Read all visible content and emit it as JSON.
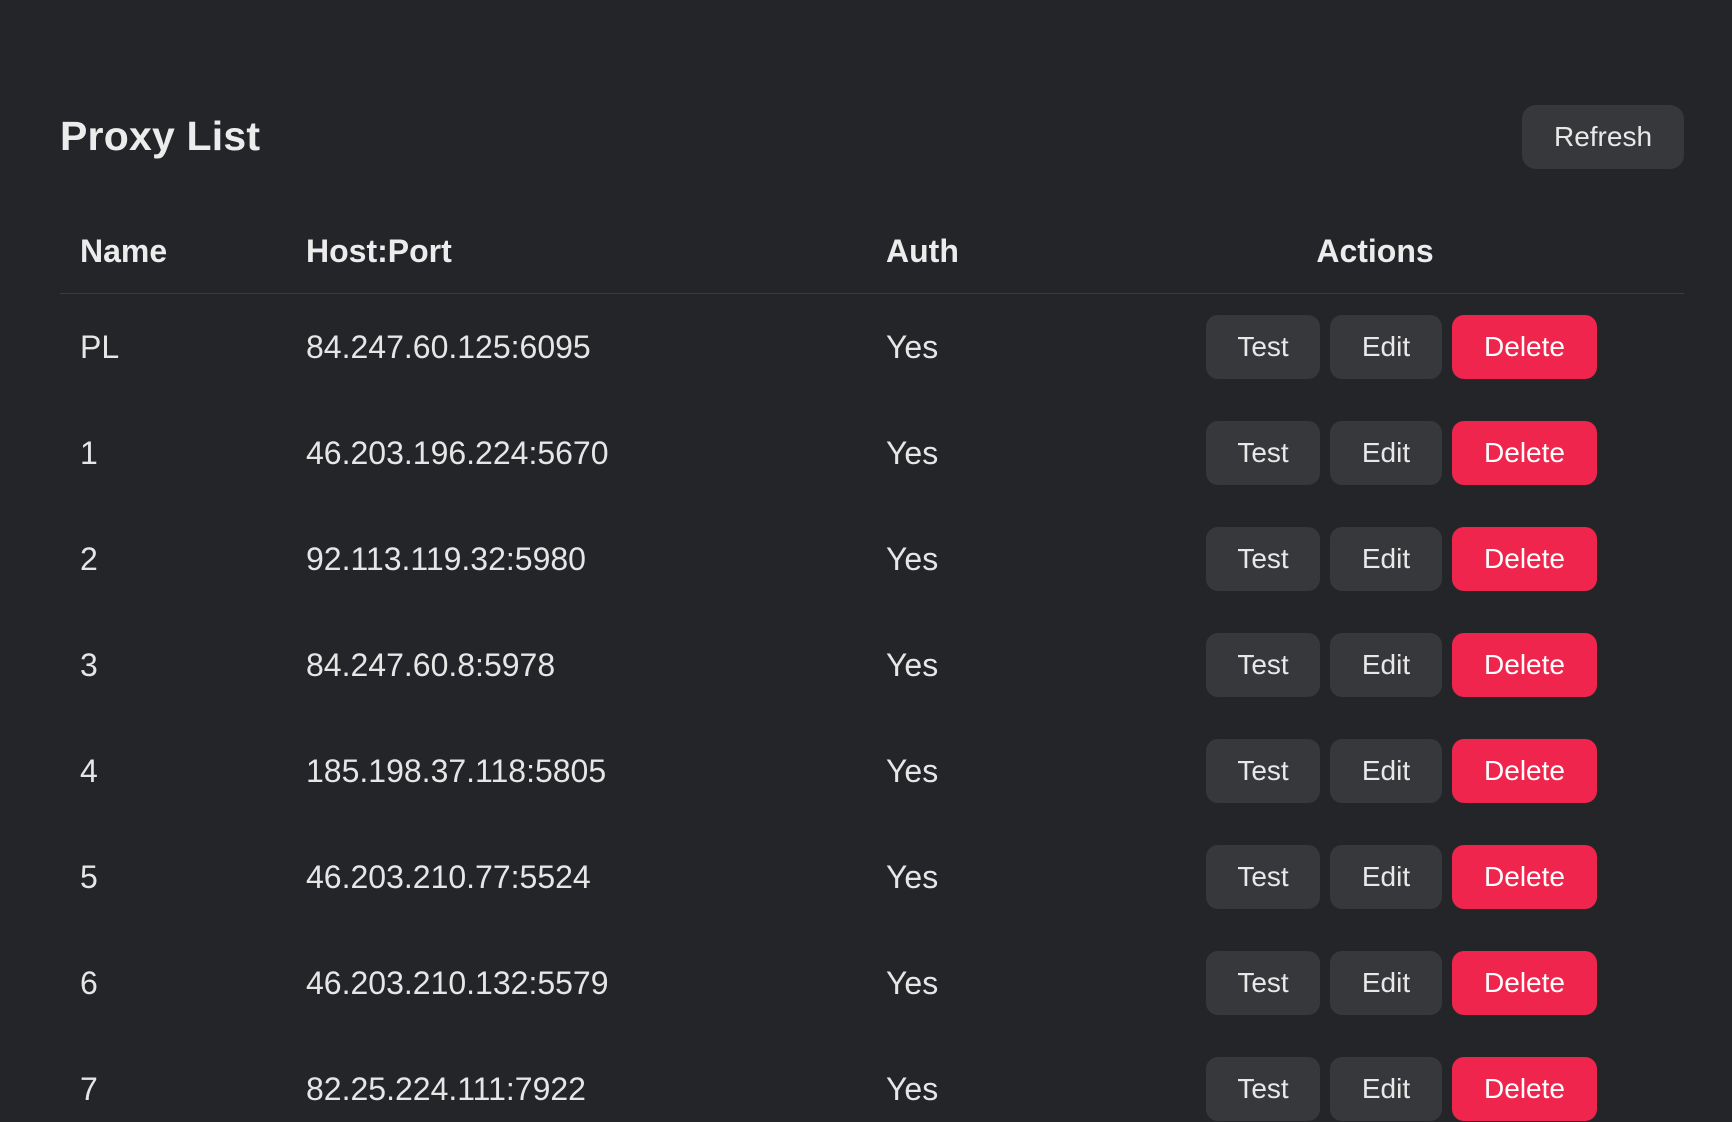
{
  "header": {
    "title": "Proxy List",
    "refresh_label": "Refresh"
  },
  "table": {
    "columns": [
      "Name",
      "Host:Port",
      "Auth",
      "Actions"
    ],
    "rows": [
      {
        "name": "PL",
        "host_port": "84.247.60.125:6095",
        "auth": "Yes"
      },
      {
        "name": "1",
        "host_port": "46.203.196.224:5670",
        "auth": "Yes"
      },
      {
        "name": "2",
        "host_port": "92.113.119.32:5980",
        "auth": "Yes"
      },
      {
        "name": "3",
        "host_port": "84.247.60.8:5978",
        "auth": "Yes"
      },
      {
        "name": "4",
        "host_port": "185.198.37.118:5805",
        "auth": "Yes"
      },
      {
        "name": "5",
        "host_port": "46.203.210.77:5524",
        "auth": "Yes"
      },
      {
        "name": "6",
        "host_port": "46.203.210.132:5579",
        "auth": "Yes"
      },
      {
        "name": "7",
        "host_port": "82.25.224.111:7922",
        "auth": "Yes"
      }
    ],
    "actions": {
      "test_label": "Test",
      "edit_label": "Edit",
      "delete_label": "Delete"
    }
  },
  "colors": {
    "background": "#242528",
    "button": "#37383b",
    "danger": "#f0254d"
  }
}
